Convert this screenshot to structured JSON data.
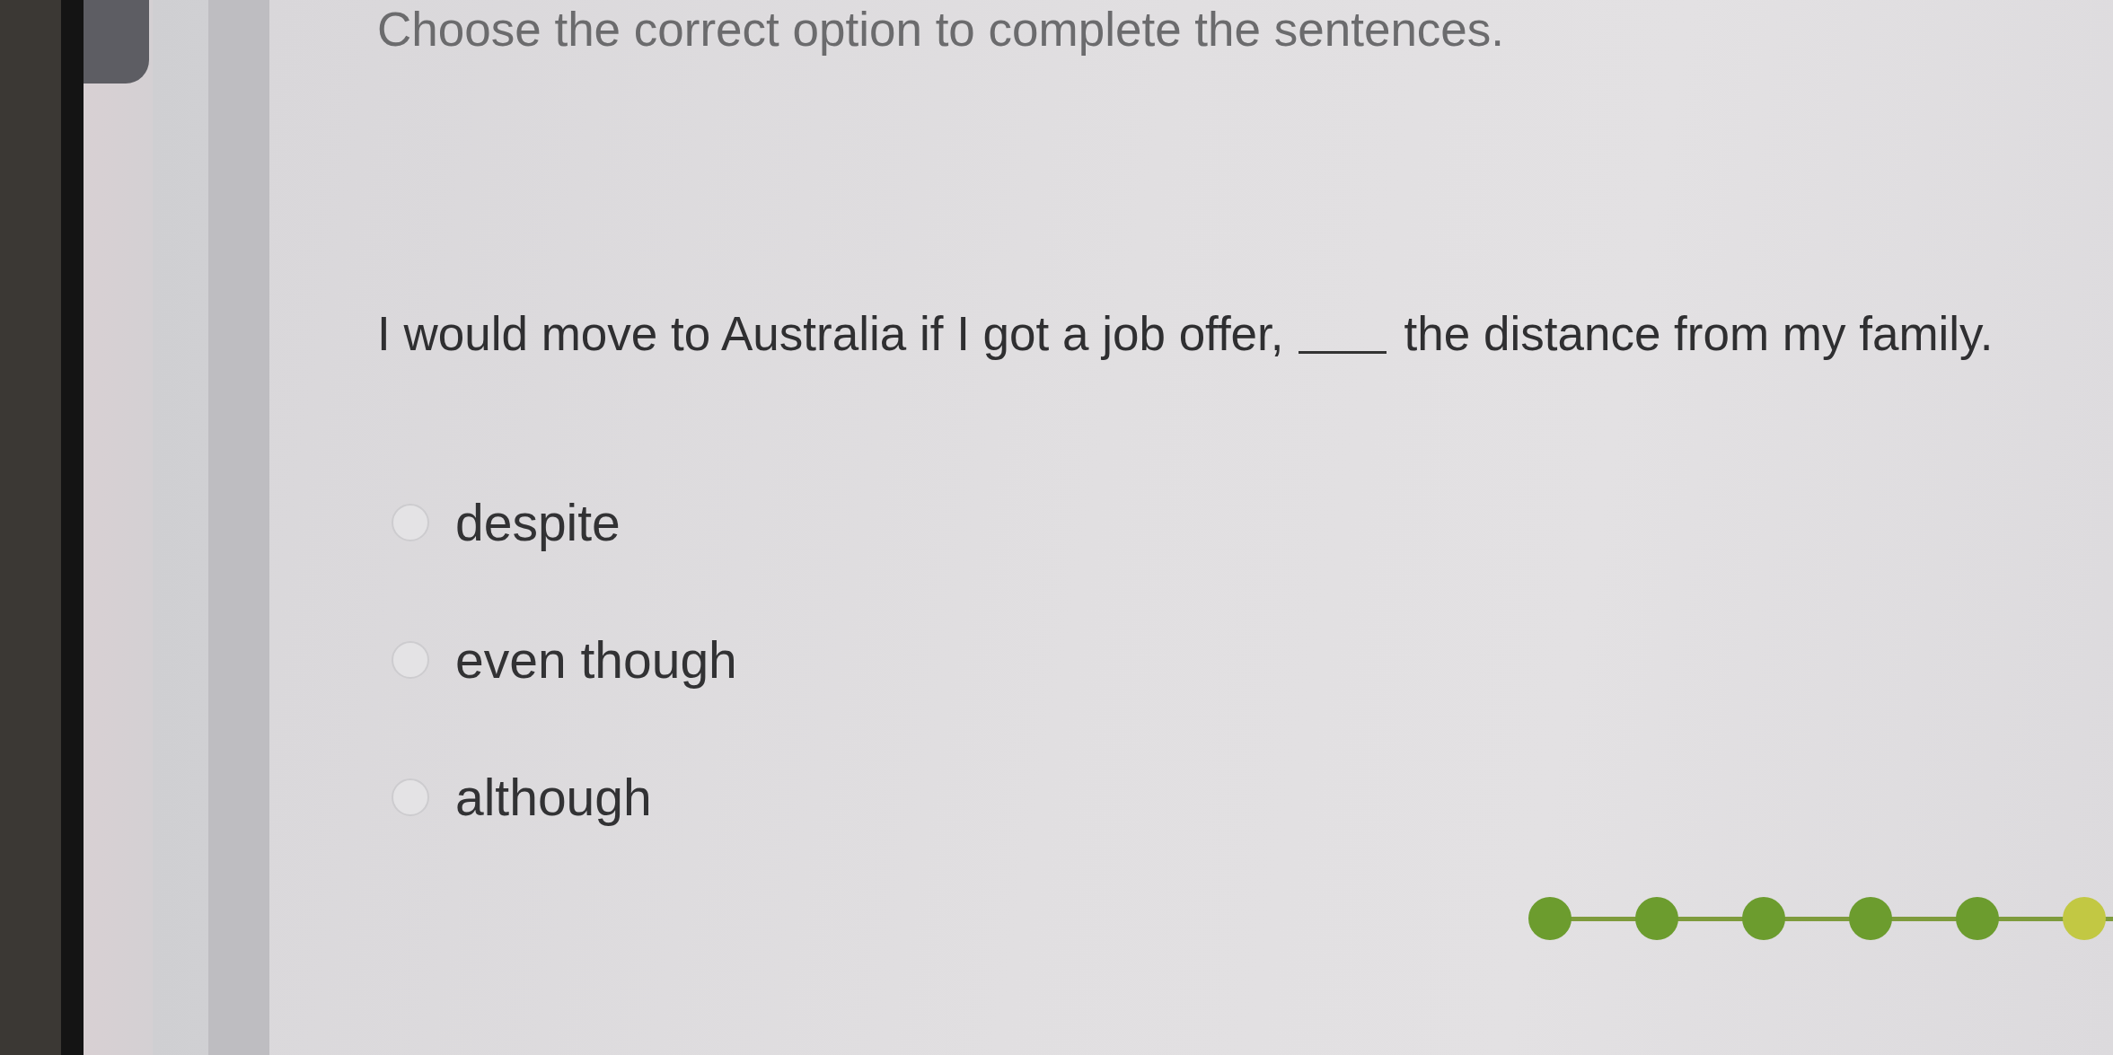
{
  "instruction": "Choose the correct option to complete the sentences.",
  "question": {
    "before_blank": "I would move to Australia if I got a job offer,",
    "after_blank": "the distance from my family."
  },
  "options": [
    {
      "label": "despite",
      "selected": false
    },
    {
      "label": "even though",
      "selected": false
    },
    {
      "label": "although",
      "selected": false
    }
  ],
  "progress": [
    {
      "current": false
    },
    {
      "current": false
    },
    {
      "current": false
    },
    {
      "current": false
    },
    {
      "current": false
    },
    {
      "current": true
    }
  ]
}
